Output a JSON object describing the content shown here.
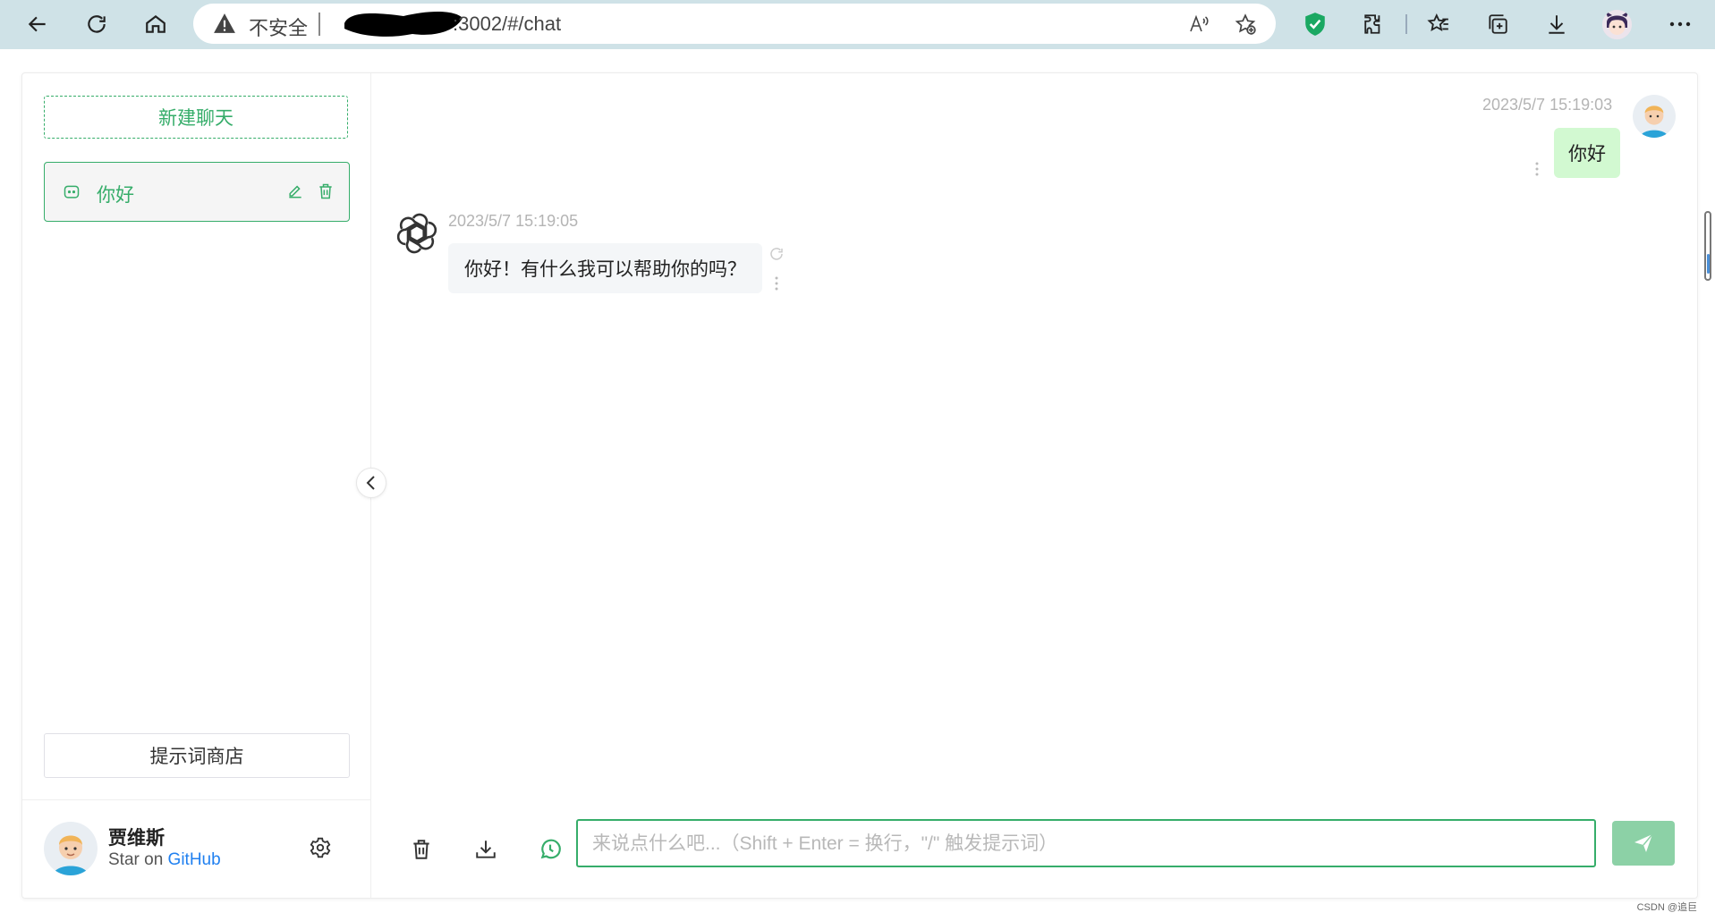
{
  "browser": {
    "security_label": "不安全",
    "url": ":3002/#/chat",
    "colors": {
      "toolbar": "#cfe2e7",
      "shield": "#1aa862"
    }
  },
  "sidebar": {
    "new_chat_label": "新建聊天",
    "history": [
      {
        "title": "你好",
        "active": true
      }
    ],
    "prompt_store_label": "提示词商店",
    "user": {
      "name": "贾维斯",
      "desc_prefix": "Star on ",
      "desc_link": "GitHub"
    }
  },
  "messages": [
    {
      "role": "user",
      "time": "2023/5/7 15:19:03",
      "text": "你好"
    },
    {
      "role": "assistant",
      "time": "2023/5/7 15:19:05",
      "text": "你好！有什么我可以帮助你的吗？"
    }
  ],
  "footer": {
    "input_value": "",
    "input_placeholder": "来说点什么吧...（Shift + Enter = 换行，\"/\" 触发提示词）"
  },
  "theme": {
    "primary": "#36ad6a",
    "user_bubble": "#d2f9d1",
    "bot_bubble": "#f4f6f8",
    "link": "#2080f0",
    "send_button": "#8cd1a6"
  },
  "watermark": "CSDN @追巨"
}
